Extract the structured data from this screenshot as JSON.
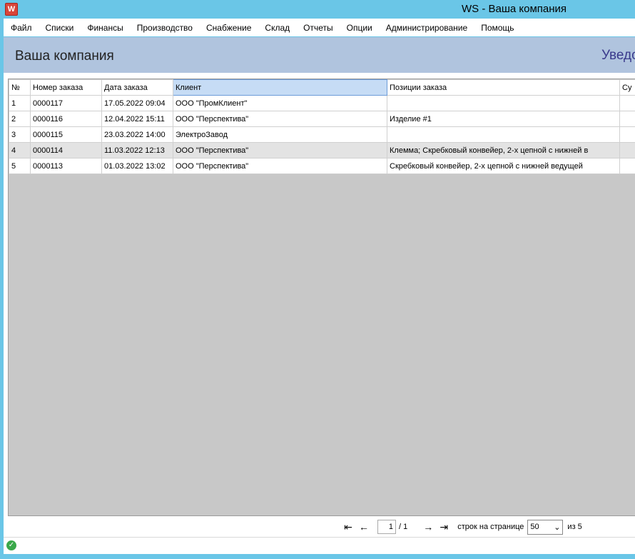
{
  "window": {
    "title": "WS - Ваша компания",
    "app_icon": "W"
  },
  "menu": [
    "Файл",
    "Списки",
    "Финансы",
    "Производство",
    "Снабжение",
    "Склад",
    "Отчеты",
    "Опции",
    "Администрирование",
    "Помощь"
  ],
  "header": {
    "company_title": "Ваша компания",
    "notifications_link": "Уведо"
  },
  "table": {
    "columns": [
      "№",
      "Номер заказа",
      "Дата заказа",
      "Клиент",
      "Позиции заказа",
      "Су"
    ],
    "selected_column": "Клиент",
    "rows": [
      [
        "1",
        "0000117",
        "17.05.2022 09:04",
        "ООО \"ПромКлиент\"",
        "",
        ""
      ],
      [
        "2",
        "0000116",
        "12.04.2022 15:11",
        "ООО \"Перспектива\"",
        "Изделие #1",
        ""
      ],
      [
        "3",
        "0000115",
        "23.03.2022 14:00",
        "ЭлектроЗавод",
        "",
        ""
      ],
      [
        "4",
        "0000114",
        "11.03.2022 12:13",
        "ООО \"Перспектива\"",
        "Клемма; Скребковый конвейер,  2-х цепной  с нижней в",
        ""
      ],
      [
        "5",
        "0000113",
        "01.03.2022 13:02",
        "ООО \"Перспектива\"",
        "Скребковый конвейер,  2-х цепной  с нижней ведущей",
        ""
      ]
    ],
    "highlighted_row": 4
  },
  "pager": {
    "first_icon": "⇤",
    "prev_icon": "←",
    "next_icon": "→",
    "last_icon": "⇥",
    "current_page": "1",
    "total_pages": "/ 1",
    "rows_per_page_label": "строк на странице",
    "rows_per_page": "50",
    "dropdown_icon": "⌄",
    "of_label": "из 5"
  },
  "status": {
    "ok_icon": "✓"
  }
}
